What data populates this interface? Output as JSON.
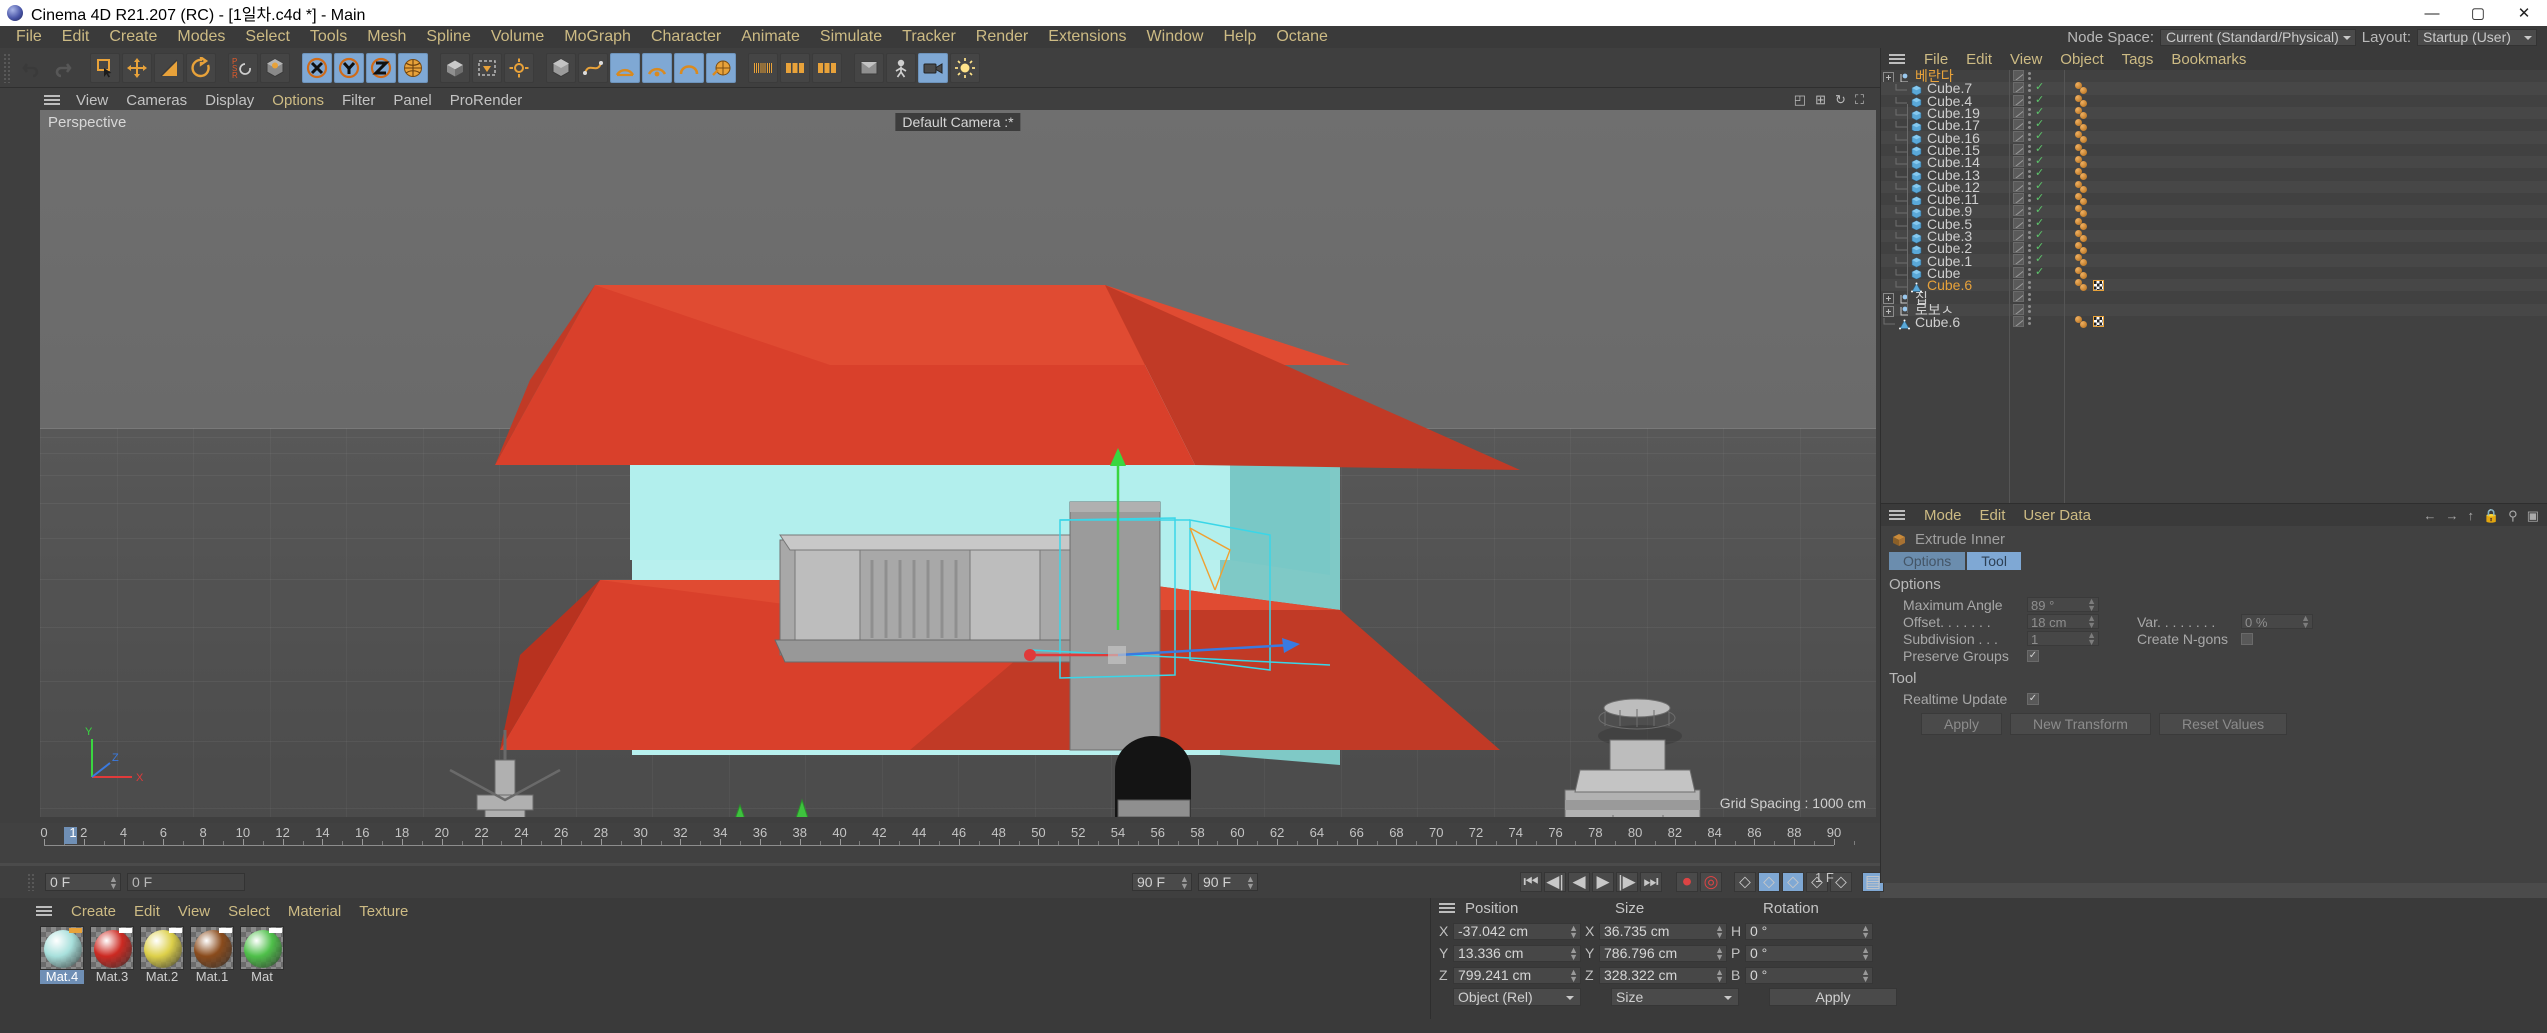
{
  "window": {
    "title": "Cinema 4D R21.207 (RC) - [1일차.c4d *] - Main",
    "minimize": "—",
    "maximize": "▢",
    "close": "✕"
  },
  "main_menu": [
    "File",
    "Edit",
    "Create",
    "Modes",
    "Select",
    "Tools",
    "Mesh",
    "Spline",
    "Volume",
    "MoGraph",
    "Character",
    "Animate",
    "Simulate",
    "Tracker",
    "Render",
    "Extensions",
    "Window",
    "Help",
    "Octane"
  ],
  "right_header": {
    "node_space_label": "Node Space:",
    "node_space_value": "Current (Standard/Physical)",
    "layout_label": "Layout:",
    "layout_value": "Startup (User)"
  },
  "viewport": {
    "menu": [
      "View",
      "Cameras",
      "Display",
      "Options",
      "Filter",
      "Panel",
      "ProRender"
    ],
    "highlight_menu": "Options",
    "perspective_label": "Perspective",
    "camera_label": "Default Camera :*",
    "grid_spacing": "Grid Spacing : 1000 cm",
    "axis_labels": {
      "x": "X",
      "y": "Y",
      "z": "Z"
    }
  },
  "timeline": {
    "ticks": [
      0,
      2,
      4,
      6,
      8,
      10,
      12,
      14,
      16,
      18,
      20,
      22,
      24,
      26,
      28,
      30,
      32,
      34,
      36,
      38,
      40,
      42,
      44,
      46,
      48,
      50,
      52,
      54,
      56,
      58,
      60,
      62,
      64,
      66,
      68,
      70,
      72,
      74,
      76,
      78,
      80,
      82,
      84,
      86,
      88,
      90
    ],
    "current_frame_marker": "1",
    "frame_field": "0 F",
    "preview_field": "0 F",
    "end_field_a": "90 F",
    "end_field_b": "90 F",
    "fps_label": "1 F"
  },
  "material_manager": {
    "menu": [
      "Create",
      "Edit",
      "View",
      "Select",
      "Material",
      "Texture"
    ],
    "materials": [
      {
        "name": "Mat.4",
        "color": "#a8e0dc",
        "selected": true,
        "tag_color": "#e8a23a"
      },
      {
        "name": "Mat.3",
        "color": "#cc2a22",
        "selected": false,
        "tag_color": "#ffffff"
      },
      {
        "name": "Mat.2",
        "color": "#ddd04a",
        "selected": false,
        "tag_color": "#ffffff"
      },
      {
        "name": "Mat.1",
        "color": "#8a4b1c",
        "selected": false,
        "tag_color": "#ffffff"
      },
      {
        "name": "Mat",
        "color": "#4fc04a",
        "selected": false,
        "tag_color": "#ffffff"
      }
    ]
  },
  "object_manager": {
    "menu": [
      "File",
      "Edit",
      "View",
      "Object",
      "Tags",
      "Bookmarks"
    ],
    "objects": [
      {
        "name": "베란다",
        "icon": "null-object-icon",
        "indent": 0,
        "selected": false,
        "name_color": "#e8a23a",
        "visible_check": false,
        "material_tags": 0,
        "checker_tag": false,
        "expandable": true
      },
      {
        "name": "Cube.7",
        "icon": "cube-icon",
        "indent": 1,
        "selected": false,
        "visible_check": true,
        "material_tags": 2,
        "checker_tag": false
      },
      {
        "name": "Cube.4",
        "icon": "cube-icon",
        "indent": 1,
        "selected": false,
        "visible_check": true,
        "material_tags": 2,
        "checker_tag": false
      },
      {
        "name": "Cube.19",
        "icon": "cube-icon",
        "indent": 1,
        "selected": false,
        "visible_check": true,
        "material_tags": 2,
        "checker_tag": false
      },
      {
        "name": "Cube.17",
        "icon": "cube-icon",
        "indent": 1,
        "selected": false,
        "visible_check": true,
        "material_tags": 2,
        "checker_tag": false
      },
      {
        "name": "Cube.16",
        "icon": "cube-icon",
        "indent": 1,
        "selected": false,
        "visible_check": true,
        "material_tags": 2,
        "checker_tag": false
      },
      {
        "name": "Cube.15",
        "icon": "cube-icon",
        "indent": 1,
        "selected": false,
        "visible_check": true,
        "material_tags": 2,
        "checker_tag": false
      },
      {
        "name": "Cube.14",
        "icon": "cube-icon",
        "indent": 1,
        "selected": false,
        "visible_check": true,
        "material_tags": 2,
        "checker_tag": false
      },
      {
        "name": "Cube.13",
        "icon": "cube-icon",
        "indent": 1,
        "selected": false,
        "visible_check": true,
        "material_tags": 2,
        "checker_tag": false
      },
      {
        "name": "Cube.12",
        "icon": "cube-icon",
        "indent": 1,
        "selected": false,
        "visible_check": true,
        "material_tags": 2,
        "checker_tag": false
      },
      {
        "name": "Cube.11",
        "icon": "cube-icon",
        "indent": 1,
        "selected": false,
        "visible_check": true,
        "material_tags": 2,
        "checker_tag": false
      },
      {
        "name": "Cube.9",
        "icon": "cube-icon",
        "indent": 1,
        "selected": false,
        "visible_check": true,
        "material_tags": 2,
        "checker_tag": false
      },
      {
        "name": "Cube.5",
        "icon": "cube-icon",
        "indent": 1,
        "selected": false,
        "visible_check": true,
        "material_tags": 2,
        "checker_tag": false
      },
      {
        "name": "Cube.3",
        "icon": "cube-icon",
        "indent": 1,
        "selected": false,
        "visible_check": true,
        "material_tags": 2,
        "checker_tag": false
      },
      {
        "name": "Cube.2",
        "icon": "cube-icon",
        "indent": 1,
        "selected": false,
        "visible_check": true,
        "material_tags": 2,
        "checker_tag": false
      },
      {
        "name": "Cube.1",
        "icon": "cube-icon",
        "indent": 1,
        "selected": false,
        "visible_check": true,
        "material_tags": 2,
        "checker_tag": false
      },
      {
        "name": "Cube",
        "icon": "cube-icon",
        "indent": 1,
        "selected": false,
        "visible_check": true,
        "material_tags": 2,
        "checker_tag": false
      },
      {
        "name": "Cube.6",
        "icon": "polygon-object-icon",
        "indent": 1,
        "selected": true,
        "name_color": "#e8a23a",
        "visible_check": false,
        "material_tags": 2,
        "checker_tag": true
      },
      {
        "name": "집",
        "icon": "null-object-icon",
        "indent": 0,
        "selected": false,
        "visible_check": false,
        "material_tags": 0,
        "checker_tag": false,
        "expandable": true
      },
      {
        "name": "로보ㅅ",
        "icon": "null-object-icon",
        "indent": 0,
        "selected": false,
        "visible_check": false,
        "material_tags": 0,
        "checker_tag": false,
        "expandable": true
      },
      {
        "name": "Cube.6",
        "icon": "polygon-object-icon",
        "indent": 0,
        "selected": false,
        "visible_check": false,
        "material_tags": 2,
        "checker_tag": true
      }
    ]
  },
  "attribute_manager": {
    "menu": [
      "Mode",
      "Edit",
      "User Data"
    ],
    "tool_name": "Extrude Inner",
    "tabs": [
      "Options",
      "Tool"
    ],
    "sections": {
      "options_title": "Options",
      "tool_title": "Tool"
    },
    "fields": {
      "maximum_angle_label": "Maximum Angle",
      "maximum_angle_value": "89 °",
      "offset_label": "Offset. . . . . . .",
      "offset_value": "18 cm",
      "var_label": "Var. . . . . . . .",
      "var_value": "0 %",
      "subdivision_label": "Subdivision . . .",
      "subdivision_value": "1",
      "create_ngons_label": "Create N-gons",
      "create_ngons_checked": false,
      "preserve_groups_label": "Preserve Groups",
      "preserve_groups_checked": true,
      "realtime_update_label": "Realtime Update",
      "realtime_update_checked": true
    },
    "buttons": [
      "Apply",
      "New Transform",
      "Reset Values"
    ]
  },
  "coordinates": {
    "columns": [
      "Position",
      "Size",
      "Rotation"
    ],
    "position": {
      "x_label": "X",
      "x": "-37.042 cm",
      "y_label": "Y",
      "y": "13.336 cm",
      "z_label": "Z",
      "z": "799.241 cm"
    },
    "size": {
      "x_label": "X",
      "x": "36.735 cm",
      "y_label": "Y",
      "y": "786.796 cm",
      "z_label": "Z",
      "z": "328.322 cm"
    },
    "rotation": {
      "h_label": "H",
      "h": "0 °",
      "p_label": "P",
      "p": "0 °",
      "b_label": "B",
      "b": "0 °"
    },
    "mode_select": "Object (Rel)",
    "size_select": "Size",
    "apply_button": "Apply"
  },
  "icons": {
    "undo": "undo-icon",
    "redo": "redo-icon",
    "live_selection": "live-selection-icon",
    "move": "move-tool-icon",
    "scale": "scale-tool-icon",
    "rotate": "rotate-tool-icon",
    "psr": "psr-icon",
    "world_object": "world-object-axis-icon",
    "x_lock": "x-axis-lock-icon",
    "y_lock": "y-axis-lock-icon",
    "z_lock": "z-axis-lock-icon",
    "coord_system": "coordinate-system-icon",
    "render_view": "render-view-icon",
    "render_region": "render-region-icon",
    "render_settings": "render-settings-icon",
    "cube_primitive": "cube-primitive-icon",
    "spline_pen": "spline-pen-icon",
    "nurbs": "generator-nurbs-icon",
    "array": "array-icon",
    "mograph_cloner": "mograph-cloner-icon",
    "mograph_effector": "mograph-effector-icon",
    "deformer": "deformer-icon",
    "camera": "camera-icon",
    "light": "light-icon",
    "floor": "floor-icon"
  }
}
